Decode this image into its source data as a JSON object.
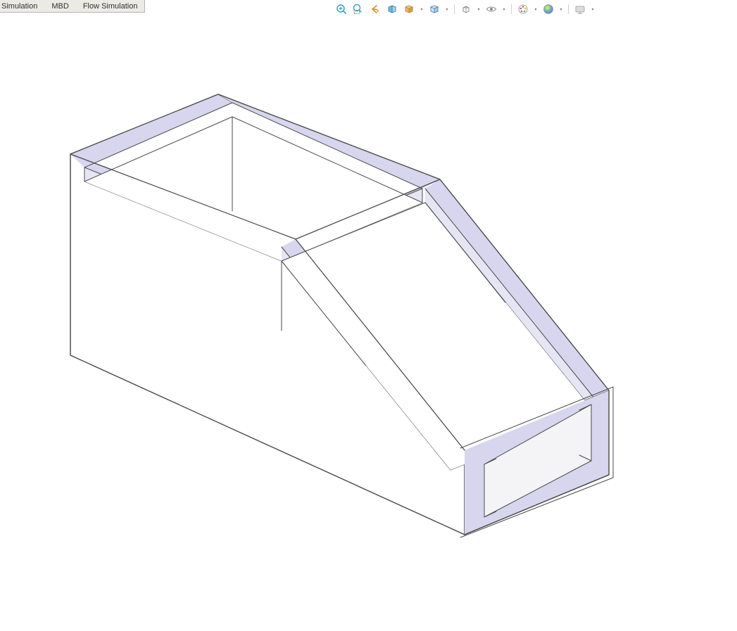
{
  "tabs": {
    "simulation": "Simulation",
    "mbd": "MBD",
    "flow_simulation": "Flow Simulation"
  },
  "hud": {
    "zoom_fit": "zoom-to-fit",
    "zoom_area": "zoom-to-area",
    "prev_view": "previous-view",
    "section_view": "section-view",
    "view_orientation": "view-orientation",
    "display_style": "display-style",
    "hide_show": "hide-show-items",
    "edit_appearance": "edit-appearance",
    "apply_scene": "apply-scene",
    "view_settings": "view-settings"
  }
}
